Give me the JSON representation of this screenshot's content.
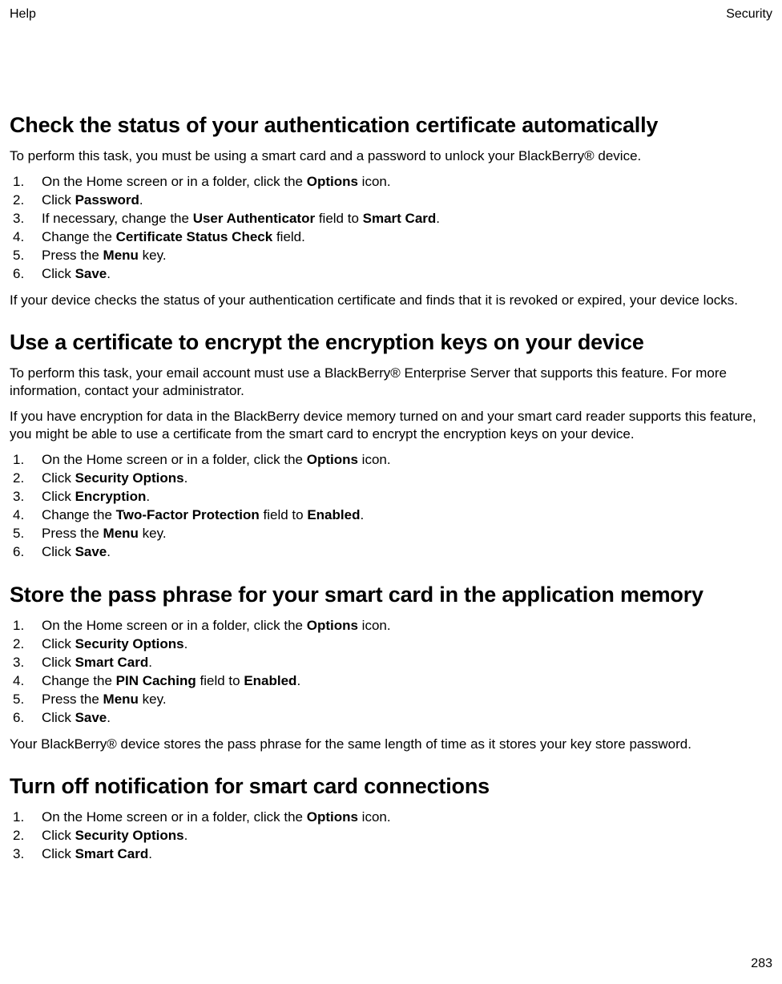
{
  "header": {
    "left": "Help",
    "right": "Security"
  },
  "pageNumber": "283",
  "sections": [
    {
      "title": "Check the status of your authentication certificate automatically",
      "intro": "To perform this task, you must be using a smart card and a password to unlock your BlackBerry® device.",
      "steps": [
        [
          {
            "t": "On the Home screen or in a folder, click the "
          },
          {
            "t": "Options",
            "b": true
          },
          {
            "t": " icon."
          }
        ],
        [
          {
            "t": "Click "
          },
          {
            "t": "Password",
            "b": true
          },
          {
            "t": "."
          }
        ],
        [
          {
            "t": "If necessary, change the "
          },
          {
            "t": "User Authenticator",
            "b": true
          },
          {
            "t": " field to "
          },
          {
            "t": "Smart Card",
            "b": true
          },
          {
            "t": "."
          }
        ],
        [
          {
            "t": "Change the "
          },
          {
            "t": "Certificate Status Check",
            "b": true
          },
          {
            "t": " field."
          }
        ],
        [
          {
            "t": "Press the "
          },
          {
            "t": "Menu",
            "b": true
          },
          {
            "t": " key."
          }
        ],
        [
          {
            "t": "Click "
          },
          {
            "t": "Save",
            "b": true
          },
          {
            "t": "."
          }
        ]
      ],
      "outro": "If your device checks the status of your authentication certificate and finds that it is revoked or expired, your device locks."
    },
    {
      "title": "Use a certificate to encrypt the encryption keys on your device",
      "intro": "To perform this task, your email account must use a BlackBerry® Enterprise Server that supports this feature. For more information, contact your administrator.",
      "intro2": "If you have encryption for data in the BlackBerry device memory turned on and your smart card reader supports this feature, you might be able to use a certificate from the smart card to encrypt the encryption keys on your device.",
      "steps": [
        [
          {
            "t": "On the Home screen or in a folder, click the "
          },
          {
            "t": "Options",
            "b": true
          },
          {
            "t": " icon."
          }
        ],
        [
          {
            "t": "Click "
          },
          {
            "t": "Security Options",
            "b": true
          },
          {
            "t": "."
          }
        ],
        [
          {
            "t": "Click "
          },
          {
            "t": "Encryption",
            "b": true
          },
          {
            "t": "."
          }
        ],
        [
          {
            "t": "Change the "
          },
          {
            "t": "Two-Factor Protection",
            "b": true
          },
          {
            "t": " field to "
          },
          {
            "t": "Enabled",
            "b": true
          },
          {
            "t": "."
          }
        ],
        [
          {
            "t": "Press the "
          },
          {
            "t": "Menu",
            "b": true
          },
          {
            "t": " key."
          }
        ],
        [
          {
            "t": "Click "
          },
          {
            "t": "Save",
            "b": true
          },
          {
            "t": "."
          }
        ]
      ]
    },
    {
      "title": "Store the pass phrase for your smart card in the application memory",
      "steps": [
        [
          {
            "t": "On the Home screen or in a folder, click the "
          },
          {
            "t": "Options",
            "b": true
          },
          {
            "t": " icon."
          }
        ],
        [
          {
            "t": "Click "
          },
          {
            "t": "Security Options",
            "b": true
          },
          {
            "t": "."
          }
        ],
        [
          {
            "t": "Click "
          },
          {
            "t": "Smart Card",
            "b": true
          },
          {
            "t": "."
          }
        ],
        [
          {
            "t": "Change the "
          },
          {
            "t": "PIN Caching",
            "b": true
          },
          {
            "t": " field to "
          },
          {
            "t": "Enabled",
            "b": true
          },
          {
            "t": "."
          }
        ],
        [
          {
            "t": "Press the "
          },
          {
            "t": "Menu",
            "b": true
          },
          {
            "t": " key."
          }
        ],
        [
          {
            "t": "Click "
          },
          {
            "t": "Save",
            "b": true
          },
          {
            "t": "."
          }
        ]
      ],
      "outro": "Your BlackBerry® device stores the pass phrase for the same length of time as it stores your key store password."
    },
    {
      "title": "Turn off notification for smart card connections",
      "steps": [
        [
          {
            "t": "On the Home screen or in a folder, click the "
          },
          {
            "t": "Options",
            "b": true
          },
          {
            "t": " icon."
          }
        ],
        [
          {
            "t": "Click "
          },
          {
            "t": "Security Options",
            "b": true
          },
          {
            "t": "."
          }
        ],
        [
          {
            "t": "Click "
          },
          {
            "t": "Smart Card",
            "b": true
          },
          {
            "t": "."
          }
        ]
      ]
    }
  ]
}
